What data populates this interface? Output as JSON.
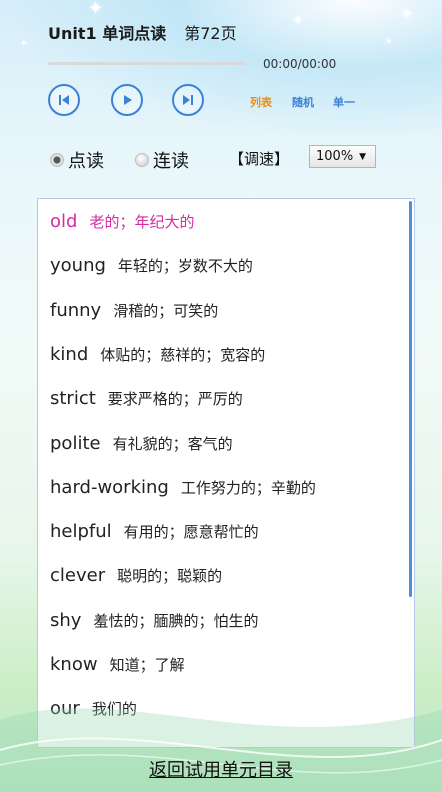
{
  "header": {
    "title": "Unit1 单词点读",
    "page": "第72页"
  },
  "player": {
    "time": "00:00/00:00",
    "progress": 0
  },
  "controls": {
    "prev_icon": "skip-previous-icon",
    "play_icon": "play-icon",
    "next_icon": "skip-next-icon"
  },
  "modes": {
    "list": "列表",
    "random": "随机",
    "single": "单一"
  },
  "read_modes": {
    "single_read": "点读",
    "continuous": "连读",
    "selected": "single_read"
  },
  "speed": {
    "label": "【调速】",
    "value": "100%"
  },
  "words": [
    {
      "en": "old",
      "cn": "老的；年纪大的",
      "active": true
    },
    {
      "en": "young",
      "cn": "年轻的；岁数不大的"
    },
    {
      "en": "funny",
      "cn": "滑稽的；可笑的"
    },
    {
      "en": "kind",
      "cn": "体贴的；慈祥的；宽容的"
    },
    {
      "en": "strict",
      "cn": "要求严格的；严厉的"
    },
    {
      "en": "polite",
      "cn": "有礼貌的；客气的"
    },
    {
      "en": "hard-working",
      "cn": "工作努力的；辛勤的"
    },
    {
      "en": "helpful",
      "cn": "有用的；愿意帮忙的"
    },
    {
      "en": "clever",
      "cn": "聪明的；聪颖的"
    },
    {
      "en": "shy",
      "cn": "羞怯的；腼腆的；怕生的"
    },
    {
      "en": "know",
      "cn": "知道；了解"
    },
    {
      "en": "our",
      "cn": "我们的"
    }
  ],
  "footer": {
    "back_link": "返回试用单元目录"
  },
  "colors": {
    "accent": "#3b82d6",
    "active_word": "#d62ca2",
    "list_mode": "#e88c1c"
  }
}
